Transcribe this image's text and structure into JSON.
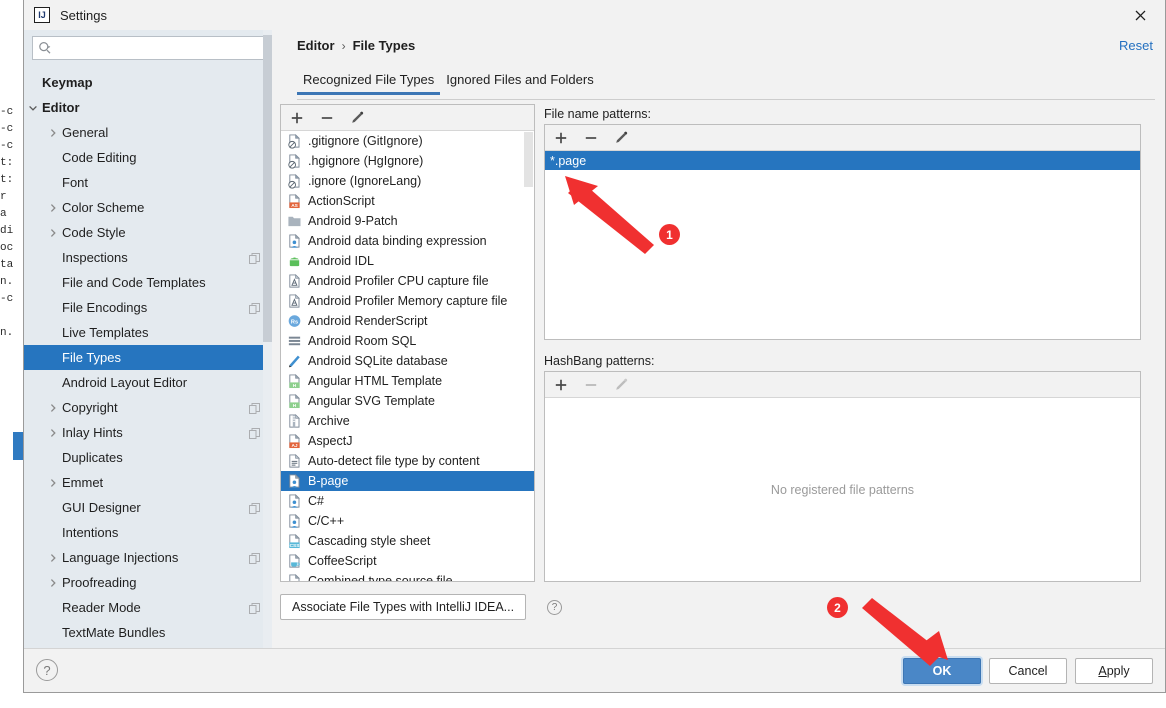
{
  "window": {
    "title": "Settings",
    "logo_icon": "intellij-idea-logo",
    "close_icon": "close-icon"
  },
  "search": {
    "placeholder": "",
    "value": "",
    "icon": "search-icon"
  },
  "sidebar": {
    "scrollbar": "vertical-scrollbar",
    "items": [
      {
        "label": "Keymap",
        "indent": 0,
        "arrow": "none",
        "bold": true,
        "selected": false,
        "copy": false
      },
      {
        "label": "Editor",
        "indent": 0,
        "arrow": "down",
        "bold": true,
        "selected": false,
        "copy": false
      },
      {
        "label": "General",
        "indent": 1,
        "arrow": "right",
        "bold": false,
        "selected": false,
        "copy": false
      },
      {
        "label": "Code Editing",
        "indent": 1,
        "arrow": "none",
        "bold": false,
        "selected": false,
        "copy": false
      },
      {
        "label": "Font",
        "indent": 1,
        "arrow": "none",
        "bold": false,
        "selected": false,
        "copy": false
      },
      {
        "label": "Color Scheme",
        "indent": 1,
        "arrow": "right",
        "bold": false,
        "selected": false,
        "copy": false
      },
      {
        "label": "Code Style",
        "indent": 1,
        "arrow": "right",
        "bold": false,
        "selected": false,
        "copy": false
      },
      {
        "label": "Inspections",
        "indent": 1,
        "arrow": "none",
        "bold": false,
        "selected": false,
        "copy": true
      },
      {
        "label": "File and Code Templates",
        "indent": 1,
        "arrow": "none",
        "bold": false,
        "selected": false,
        "copy": false
      },
      {
        "label": "File Encodings",
        "indent": 1,
        "arrow": "none",
        "bold": false,
        "selected": false,
        "copy": true
      },
      {
        "label": "Live Templates",
        "indent": 1,
        "arrow": "none",
        "bold": false,
        "selected": false,
        "copy": false
      },
      {
        "label": "File Types",
        "indent": 1,
        "arrow": "none",
        "bold": false,
        "selected": true,
        "copy": false
      },
      {
        "label": "Android Layout Editor",
        "indent": 1,
        "arrow": "none",
        "bold": false,
        "selected": false,
        "copy": false
      },
      {
        "label": "Copyright",
        "indent": 1,
        "arrow": "right",
        "bold": false,
        "selected": false,
        "copy": true
      },
      {
        "label": "Inlay Hints",
        "indent": 1,
        "arrow": "right",
        "bold": false,
        "selected": false,
        "copy": true
      },
      {
        "label": "Duplicates",
        "indent": 1,
        "arrow": "none",
        "bold": false,
        "selected": false,
        "copy": false
      },
      {
        "label": "Emmet",
        "indent": 1,
        "arrow": "right",
        "bold": false,
        "selected": false,
        "copy": false
      },
      {
        "label": "GUI Designer",
        "indent": 1,
        "arrow": "none",
        "bold": false,
        "selected": false,
        "copy": true
      },
      {
        "label": "Intentions",
        "indent": 1,
        "arrow": "none",
        "bold": false,
        "selected": false,
        "copy": false
      },
      {
        "label": "Language Injections",
        "indent": 1,
        "arrow": "right",
        "bold": false,
        "selected": false,
        "copy": true
      },
      {
        "label": "Proofreading",
        "indent": 1,
        "arrow": "right",
        "bold": false,
        "selected": false,
        "copy": false
      },
      {
        "label": "Reader Mode",
        "indent": 1,
        "arrow": "none",
        "bold": false,
        "selected": false,
        "copy": true
      },
      {
        "label": "TextMate Bundles",
        "indent": 1,
        "arrow": "none",
        "bold": false,
        "selected": false,
        "copy": false
      }
    ]
  },
  "breadcrumb": {
    "parent": "Editor",
    "separator": "›",
    "current": "File Types"
  },
  "reset_label": "Reset",
  "tabs": [
    {
      "label": "Recognized File Types",
      "active": true
    },
    {
      "label": "Ignored Files and Folders",
      "active": false
    }
  ],
  "file_types": {
    "toolbar": [
      {
        "icon": "add-icon",
        "label": "+",
        "enabled": true
      },
      {
        "icon": "remove-icon",
        "label": "−",
        "enabled": true
      },
      {
        "icon": "edit-pencil-icon",
        "label": "",
        "enabled": true
      }
    ],
    "items": [
      {
        "label": ".gitignore (GitIgnore)",
        "icon": "gitignore-file-icon",
        "selected": false
      },
      {
        "label": ".hgignore (HgIgnore)",
        "icon": "hgignore-file-icon",
        "selected": false
      },
      {
        "label": ".ignore (IgnoreLang)",
        "icon": "ignorelang-file-icon",
        "selected": false
      },
      {
        "label": "ActionScript",
        "icon": "actionscript-file-icon",
        "selected": false
      },
      {
        "label": "Android 9-Patch",
        "icon": "folder-icon",
        "selected": false
      },
      {
        "label": "Android data binding expression",
        "icon": "android-databinding-icon",
        "selected": false
      },
      {
        "label": "Android IDL",
        "icon": "android-robot-icon",
        "selected": false
      },
      {
        "label": "Android Profiler CPU capture file",
        "icon": "android-profiler-icon",
        "selected": false
      },
      {
        "label": "Android Profiler Memory capture file",
        "icon": "android-profiler-icon",
        "selected": false
      },
      {
        "label": "Android RenderScript",
        "icon": "renderscript-icon",
        "selected": false
      },
      {
        "label": "Android Room SQL",
        "icon": "sql-rows-icon",
        "selected": false
      },
      {
        "label": "Android SQLite database",
        "icon": "sqlite-database-icon",
        "selected": false
      },
      {
        "label": "Angular HTML Template",
        "icon": "angular-html-icon",
        "selected": false
      },
      {
        "label": "Angular SVG Template",
        "icon": "angular-svg-icon",
        "selected": false
      },
      {
        "label": "Archive",
        "icon": "archive-icon",
        "selected": false
      },
      {
        "label": "AspectJ",
        "icon": "aspectj-file-icon",
        "selected": false
      },
      {
        "label": "Auto-detect file type by content",
        "icon": "text-file-icon",
        "selected": false
      },
      {
        "label": "B-page",
        "icon": "custom-file-type-icon",
        "selected": true
      },
      {
        "label": "C#",
        "icon": "custom-file-type-icon",
        "selected": false
      },
      {
        "label": "C/C++",
        "icon": "custom-file-type-icon",
        "selected": false
      },
      {
        "label": "Cascading style sheet",
        "icon": "css-file-icon",
        "selected": false
      },
      {
        "label": "CoffeeScript",
        "icon": "coffeescript-file-icon",
        "selected": false
      },
      {
        "label": "Combined type source file",
        "icon": "generic-file-icon",
        "selected": false
      }
    ]
  },
  "file_name_patterns": {
    "label": "File name patterns:",
    "toolbar": [
      {
        "icon": "add-icon",
        "label": "+",
        "enabled": true
      },
      {
        "icon": "remove-icon",
        "label": "−",
        "enabled": true
      },
      {
        "icon": "edit-pencil-icon",
        "label": "",
        "enabled": true
      }
    ],
    "items": [
      {
        "label": "*.page",
        "selected": true
      }
    ]
  },
  "hashbang_patterns": {
    "label": "HashBang patterns:",
    "toolbar": [
      {
        "icon": "add-icon",
        "label": "+",
        "enabled": true
      },
      {
        "icon": "remove-icon",
        "label": "−",
        "enabled": false
      },
      {
        "icon": "edit-pencil-icon",
        "label": "",
        "enabled": false
      }
    ],
    "empty_message": "No registered file patterns"
  },
  "associate": {
    "label": "Associate File Types with IntelliJ IDEA...",
    "help_icon": "help-icon",
    "help_label": "?"
  },
  "footer": {
    "help_icon": "help-icon",
    "help_label": "?",
    "buttons": [
      {
        "label": "OK",
        "primary": true,
        "mnemonic": ""
      },
      {
        "label": "Cancel",
        "primary": false,
        "mnemonic": ""
      },
      {
        "label": "Apply",
        "primary": false,
        "mnemonic": "A"
      }
    ]
  },
  "annotations": [
    {
      "number": "1",
      "target": "file-name-pattern-page"
    },
    {
      "number": "2",
      "target": "ok-button"
    }
  ],
  "colors": {
    "accent_blue": "#2675bf",
    "button_blue": "#4a87c7",
    "link_blue": "#2470c0",
    "annotation_red": "#f03030",
    "sidebar_bg": "#e4eaef",
    "dialog_bg": "#f2f2f2"
  },
  "bg_ide_text": "-c\n-c\n-c\nt:\nt:\nr\na\ndi\noc\nta\nn.\n-c\n\nn.\n"
}
